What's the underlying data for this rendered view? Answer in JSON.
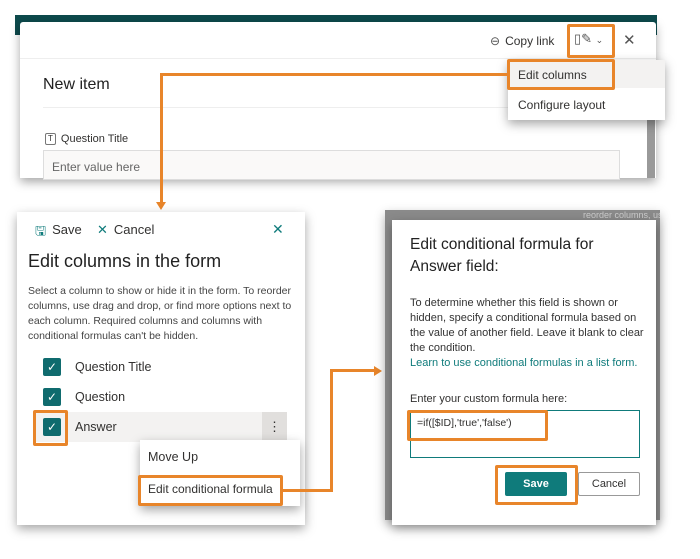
{
  "top_panel": {
    "copy_link": "Copy link",
    "title": "New item",
    "menu": [
      "Edit columns",
      "Configure layout"
    ],
    "field_label": "Question Title",
    "field_placeholder": "Enter value here"
  },
  "edit_columns": {
    "save": "Save",
    "cancel": "Cancel",
    "title": "Edit columns in the form",
    "description": "Select a column to show or hide it in the form. To reorder columns, use drag and drop, or find more options next to each column. Required columns and columns with conditional formulas can't be hidden.",
    "columns": [
      {
        "label": "Question Title",
        "checked": true
      },
      {
        "label": "Question",
        "checked": true
      },
      {
        "label": "Answer",
        "checked": true
      }
    ],
    "context_menu": [
      "Move Up",
      "Edit conditional formula"
    ]
  },
  "formula_dialog": {
    "background_text": "reorder columns, us",
    "title": "Edit conditional formula for Answer field:",
    "description": "To determine whether this field is shown or hidden, specify a conditional formula based on the value of another field. Leave it blank to clear the condition.",
    "link": "Learn to use conditional formulas in a list form.",
    "input_label": "Enter your custom formula here:",
    "formula": "=if([$ID],'true','false')",
    "save": "Save",
    "cancel": "Cancel"
  },
  "colors": {
    "accent": "#0f7b7b",
    "highlight": "#e8852a"
  }
}
